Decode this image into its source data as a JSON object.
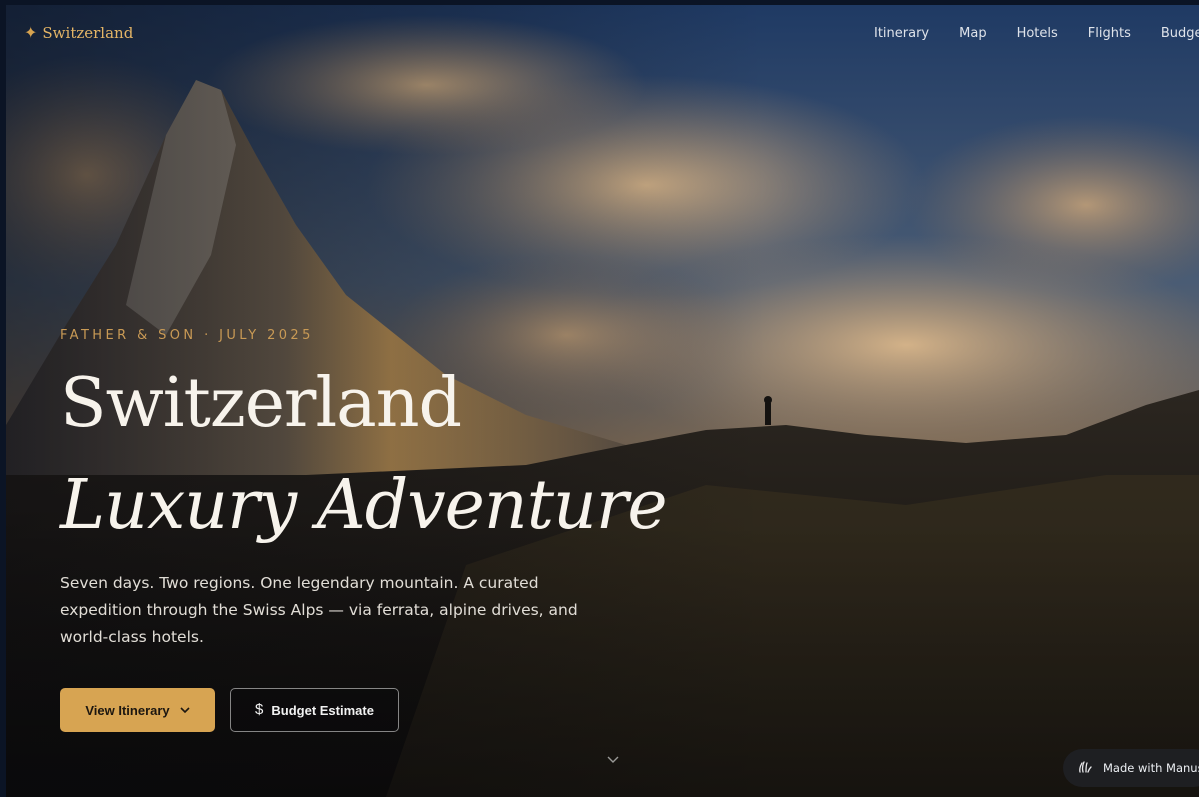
{
  "brand": {
    "name": "Switzerland",
    "icon": "star-icon"
  },
  "nav": {
    "items": [
      "Itinerary",
      "Map",
      "Hotels",
      "Flights",
      "Budget"
    ]
  },
  "hero": {
    "eyebrow": "FATHER & SON · JULY 2025",
    "title_line1": "Switzerland",
    "title_line2": "Luxury Adventure",
    "description": "Seven days. Two regions. One legendary mountain. A curated expedition through the Swiss Alps — via ferrata, alpine drives, and world-class hotels.",
    "primary_button": "View Itinerary",
    "secondary_button": "Budget Estimate"
  },
  "badge": {
    "label": "Made with Manus"
  },
  "colors": {
    "accent": "#d7a452",
    "brand_text": "#e4b566",
    "eyebrow": "#c99a55",
    "background": "#0b1425"
  }
}
